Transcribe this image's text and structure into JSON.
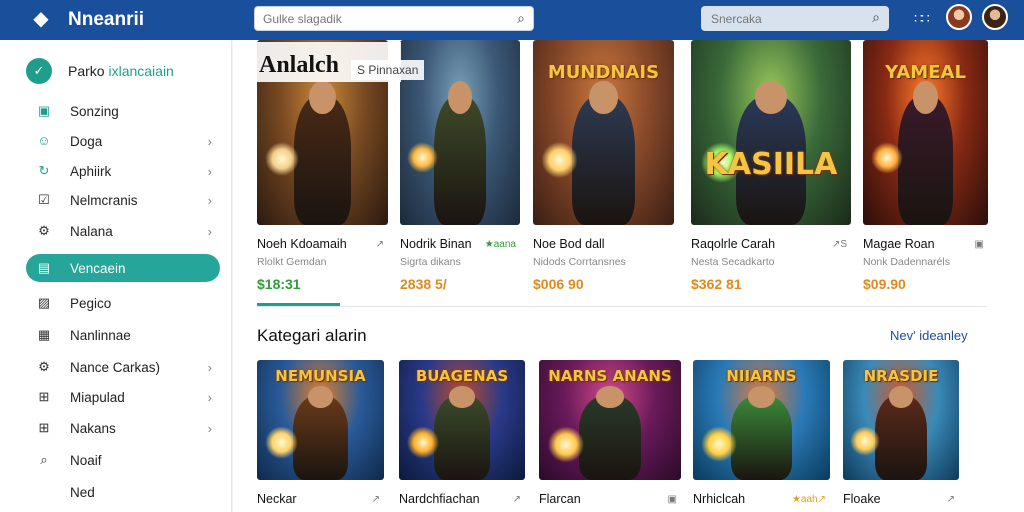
{
  "header": {
    "app_title": "Nneanrii",
    "search_placeholder": "Gulke slagadik",
    "search2_placeholder": "Snercaka",
    "logo_icon": "diamond-logo-icon",
    "grid_icon": "apps-grid-icon"
  },
  "sidebar": {
    "head_label_1": "Parko",
    "head_label_2": "ixlancaiain",
    "items": [
      {
        "label": "Sonzing",
        "icon": "store-icon",
        "chevron": false,
        "active": false
      },
      {
        "label": "Doga",
        "icon": "user-icon",
        "chevron": true,
        "active": false
      },
      {
        "label": "Aphiirk",
        "icon": "refresh-icon",
        "chevron": true,
        "active": false
      },
      {
        "label": "Nelmcranis",
        "icon": "check-box-icon",
        "chevron": true,
        "active": false
      },
      {
        "label": "Nalana",
        "icon": "settings-icon",
        "chevron": true,
        "active": false
      },
      {
        "label": "Vencaein",
        "icon": "library-icon",
        "chevron": false,
        "active": true
      },
      {
        "label": "Pegico",
        "icon": "image-icon",
        "chevron": false,
        "active": false
      },
      {
        "label": "Nanlinnae",
        "icon": "calendar-icon",
        "chevron": false,
        "active": false
      },
      {
        "label": "Nance Carkas)",
        "icon": "gear-icon",
        "chevron": true,
        "active": false
      },
      {
        "label": "Miapulad",
        "icon": "gamepad-icon",
        "chevron": true,
        "active": false
      },
      {
        "label": "Nakans",
        "icon": "grid-icon",
        "chevron": true,
        "active": false
      },
      {
        "label": "Noaif",
        "icon": "search-icon",
        "chevron": false,
        "active": false
      },
      {
        "label": "Ned",
        "icon": "",
        "chevron": false,
        "active": false
      }
    ]
  },
  "hero": {
    "title": "Anlalch",
    "subtitle": "S Pinnaxan"
  },
  "featured": [
    {
      "name": "Noeh Kdoamaih",
      "badge": "↗",
      "sub": "Rlolkt Gemdan",
      "price": "$18:31",
      "price_color": "#2e9d3a",
      "art_text": ""
    },
    {
      "name": "Nodrik Binan",
      "badge": "★aana",
      "sub": "Sigrta dikans",
      "price": "2838 5/",
      "price_color": "#e08a1e",
      "art_text": ""
    },
    {
      "name": "Noe Bod dall",
      "badge": "",
      "sub": "Nidods Corrtansnes",
      "price": "$006 90",
      "price_color": "#e08a1e",
      "art_text": "MUNDNAIS"
    },
    {
      "name": "Raqolrle Carah",
      "badge": "↗S",
      "sub": "Nesta Secadkarto",
      "price": "$362 81",
      "price_color": "#e08a1e",
      "art_text": "KASIILA"
    },
    {
      "name": "Magae Roan",
      "badge": "▣",
      "sub": "Nonk Dadennaréls",
      "price": "$09.90",
      "price_color": "#e08a1e",
      "art_text": "YAMEAL"
    }
  ],
  "categories_section": {
    "title": "Kategari alarin",
    "view_all": "Nev' ideanley"
  },
  "categories": [
    {
      "name": "Neckar",
      "badge": "↗",
      "art_text": "NEMUNSIA"
    },
    {
      "name": "Nardchfiachan",
      "badge": "↗",
      "art_text": "BUAGENAS"
    },
    {
      "name": "Flarcan",
      "badge": "▣",
      "art_text": "NARNS ANANS"
    },
    {
      "name": "Nrhiclcah",
      "badge": "★aah↗",
      "art_text": "NIIARNS"
    },
    {
      "name": "Floake",
      "badge": "↗",
      "art_text": "NRASDIE"
    }
  ]
}
